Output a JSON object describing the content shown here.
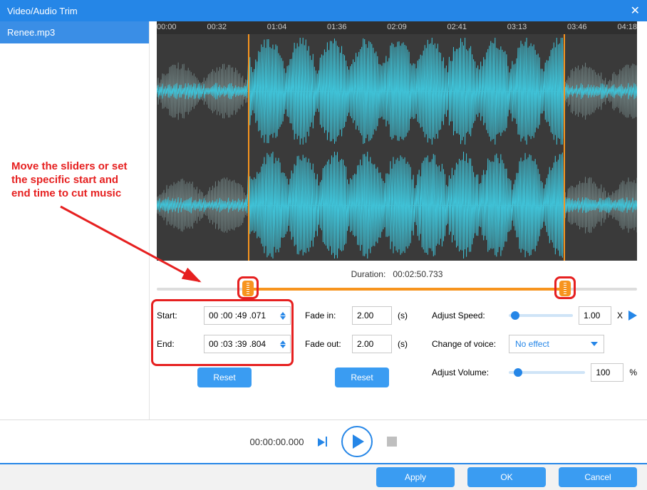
{
  "title": "Video/Audio Trim",
  "file": "Renee.mp3",
  "ruler": [
    "00:00",
    "00:32",
    "01:04",
    "01:36",
    "02:09",
    "02:41",
    "03:13",
    "03:46",
    "04:18"
  ],
  "durationLabel": "Duration:",
  "duration": "00:02:50.733",
  "startLabel": "Start:",
  "start": "00 :00 :49 .071",
  "endLabel": "End:",
  "end": "00 :03 :39 .804",
  "fadeInLabel": "Fade in:",
  "fadeIn": "2.00",
  "fadeOutLabel": "Fade out:",
  "fadeOut": "2.00",
  "secUnit": "(s)",
  "resetLabel": "Reset",
  "speedLabel": "Adjust Speed:",
  "speed": "1.00",
  "speedUnit": "X",
  "voiceLabel": "Change of voice:",
  "voiceValue": "No effect",
  "volumeLabel": "Adjust Volume:",
  "volume": "100",
  "volumeUnit": "%",
  "playTime": "00:00:00.000",
  "apply": "Apply",
  "ok": "OK",
  "cancel": "Cancel",
  "annotation": "Move the sliders or set the specific start and end time to cut music",
  "selLeftPct": 19,
  "selRightPct": 85
}
